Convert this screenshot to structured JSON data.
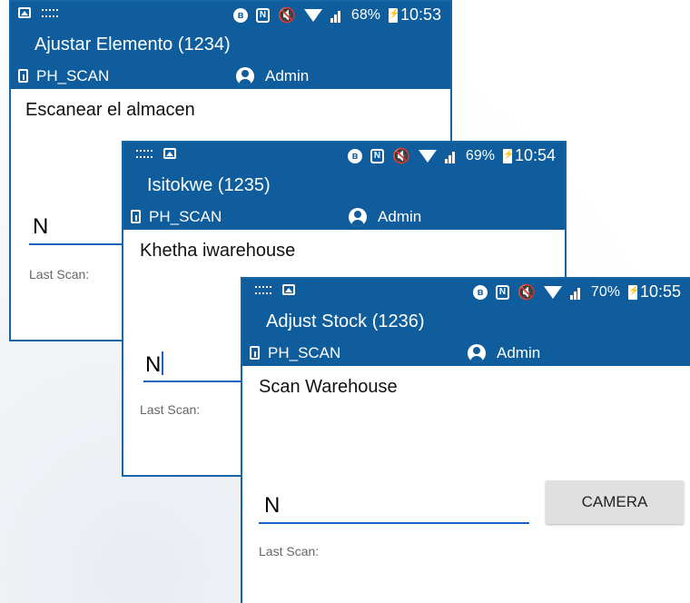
{
  "screens": [
    {
      "status": {
        "battery": "68%",
        "time": "10:53"
      },
      "title": "Ajustar Elemento (1234)",
      "device": "PH_SCAN",
      "user": "Admin",
      "heading": "Escanear el almacen",
      "scan_value": "N",
      "last_scan_label": "Last Scan:"
    },
    {
      "status": {
        "battery": "69%",
        "time": "10:54"
      },
      "title": "Isitokwe (1235)",
      "device": "PH_SCAN",
      "user": "Admin",
      "heading": "Khetha iwarehouse",
      "scan_value": "N",
      "last_scan_label": "Last Scan:"
    },
    {
      "status": {
        "battery": "70%",
        "time": "10:55"
      },
      "title": "Adjust Stock (1236)",
      "device": "PH_SCAN",
      "user": "Admin",
      "heading": "Scan Warehouse",
      "scan_value": "N",
      "last_scan_label": "Last Scan:",
      "camera_label": "CAMERA"
    }
  ],
  "colors": {
    "app_bar": "#0f5d9c",
    "input_underline": "#1565c0",
    "button_bg": "#e0e0e0"
  }
}
